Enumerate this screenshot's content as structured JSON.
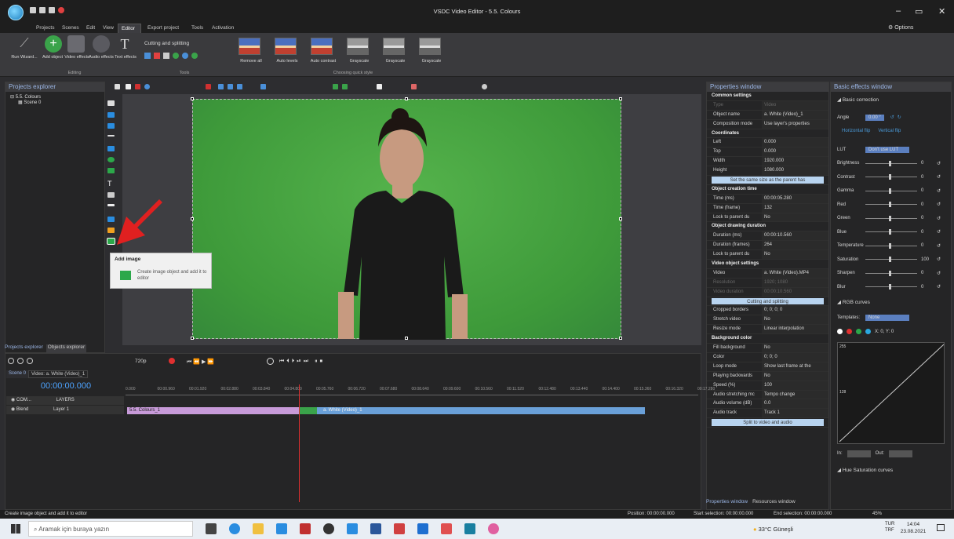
{
  "window": {
    "title": "VSDC Video Editor - 5.5. Colours",
    "options_label": "Options"
  },
  "menu": {
    "tabs": [
      "Projects",
      "Scenes",
      "Edit",
      "View",
      "Editor",
      "Export project",
      "Tools",
      "Activation"
    ],
    "active": "Editor"
  },
  "ribbon": {
    "buttons": [
      {
        "label": "Run Wizard...",
        "icon": "wand-icon"
      },
      {
        "label": "Add object",
        "icon": "plus-icon"
      },
      {
        "label": "Video effects",
        "icon": "film-icon"
      },
      {
        "label": "Audio effects",
        "icon": "headphones-icon"
      },
      {
        "label": "Text effects",
        "icon": "text-icon"
      }
    ],
    "editing_group": "Editing",
    "cutting_label": "Cutting and splitting",
    "tools_group": "Tools",
    "quick_styles": [
      "Remove all",
      "Auto levels",
      "Auto contrast",
      "Grayscale",
      "Grayscale",
      "Grayscale"
    ],
    "quick_group": "Choosing quick style"
  },
  "explorer": {
    "title": "Projects explorer",
    "project": "5.5. Colours",
    "scene": "Scene 0",
    "tab_active": "Projects explorer",
    "tab_other": "Objects explorer"
  },
  "tooltip": {
    "title": "Add image",
    "desc": "Create image object and add it to editor"
  },
  "timeline": {
    "tab_scene": "Scene 0",
    "tab_video": "Video: a. White (Video)_1",
    "resolution": "720p",
    "time": "00:00:00.000",
    "ruler": [
      "0.000",
      "00:00.960",
      "00:01.920",
      "00:02.880",
      "00:03.840",
      "00:04.800",
      "00:05.760",
      "00:06.720",
      "00:07.680",
      "00:08.640",
      "00:09.600",
      "00:10.560",
      "00:11.520",
      "00:12.480",
      "00:13.440",
      "00:14.400",
      "00:15.360",
      "00:16.320",
      "00:17.280"
    ],
    "track1": "COM...",
    "layers": "LAYERS",
    "blend": "Blend",
    "layer1": "Layer 1",
    "clip_a": "5.5. Colours_1",
    "clip_b": "a. White (Video)_1"
  },
  "properties": {
    "title": "Properties window",
    "rows": [
      {
        "s": "Common settings"
      },
      {
        "k": "Type",
        "v": "Video",
        "dim": true
      },
      {
        "k": "Object name",
        "v": "a. White (Video)_1"
      },
      {
        "k": "Composition mode",
        "v": "Use layer's properties"
      },
      {
        "s": "Coordinates"
      },
      {
        "k": "Left",
        "v": "0.000"
      },
      {
        "k": "Top",
        "v": "0.000"
      },
      {
        "k": "Width",
        "v": "1920.000"
      },
      {
        "k": "Height",
        "v": "1080.000"
      },
      {
        "b": "Set the same size as the parent has"
      },
      {
        "s": "Object creation time"
      },
      {
        "k": "Time (ms)",
        "v": "00:00:05.280"
      },
      {
        "k": "Time (frame)",
        "v": "132"
      },
      {
        "k": "Lock to parent du",
        "v": "No"
      },
      {
        "s": "Object drawing duration"
      },
      {
        "k": "Duration (ms)",
        "v": "00:00:10.560"
      },
      {
        "k": "Duration (frames)",
        "v": "264"
      },
      {
        "k": "Lock to parent du",
        "v": "No"
      },
      {
        "s": "Video object settings"
      },
      {
        "k": "Video",
        "v": "a. White (Video).MP4"
      },
      {
        "k": "Resolution",
        "v": "1920; 1080",
        "dim": true
      },
      {
        "k": "Video duration",
        "v": "00:00:10.560",
        "dim": true
      },
      {
        "b": "Cutting and splitting"
      },
      {
        "k": "Cropped borders",
        "v": "0; 0; 0; 0"
      },
      {
        "k": "Stretch video",
        "v": "No"
      },
      {
        "k": "Resize mode",
        "v": "Linear interpolation"
      },
      {
        "s": "Background color"
      },
      {
        "k": "Fill background",
        "v": "No"
      },
      {
        "k": "Color",
        "v": "0; 0; 0"
      },
      {
        "k": "Loop mode",
        "v": "Show last frame at the"
      },
      {
        "k": "Playing backwards",
        "v": "No"
      },
      {
        "k": "Speed (%)",
        "v": "100"
      },
      {
        "k": "Audio stretching mc",
        "v": "Tempo change"
      },
      {
        "k": "Audio volume (dB)",
        "v": "0.0"
      },
      {
        "k": "Audio track",
        "v": "Track 1"
      },
      {
        "b": "Split to video and audio"
      }
    ],
    "tab_active": "Properties window",
    "tab_other": "Resources window"
  },
  "basic": {
    "title": "Basic effects window",
    "section": "Basic correction",
    "angle_label": "Angle",
    "angle_value": "0.00 °",
    "hflip": "Horizontal flip",
    "vflip": "Vertical flip",
    "lut_label": "LUT",
    "lut_value": "Don't use LUT",
    "sliders": [
      {
        "label": "Brightness",
        "value": "0"
      },
      {
        "label": "Contrast",
        "value": "0"
      },
      {
        "label": "Gamma",
        "value": "0"
      },
      {
        "label": "Red",
        "value": "0"
      },
      {
        "label": "Green",
        "value": "0"
      },
      {
        "label": "Blue",
        "value": "0"
      },
      {
        "label": "Temperature",
        "value": "0"
      },
      {
        "label": "Saturation",
        "value": "100"
      },
      {
        "label": "Sharpen",
        "value": "0"
      },
      {
        "label": "Blur",
        "value": "0"
      }
    ],
    "rgb": "RGB curves",
    "templates_label": "Templates:",
    "templates_value": "None",
    "xy": "X: 0, Y: 0",
    "curve_top": "255",
    "curve_mid": "128",
    "in_label": "In:",
    "out_label": "Out:",
    "hue": "Hue Saturation curves"
  },
  "status": {
    "left": "Create image object and add it to editor",
    "position": "Position:  00:00:00.000",
    "start": "Start selection:  00:00:00.000",
    "end": "End selection:  00:00:00.000",
    "zoom": "45%"
  },
  "taskbar": {
    "search": "Aramak için buraya yazın",
    "weather": "33°C  Güneşli",
    "lang": "TUR",
    "lang2": "TRF",
    "time": "14:04",
    "date": "23.08.2021"
  }
}
